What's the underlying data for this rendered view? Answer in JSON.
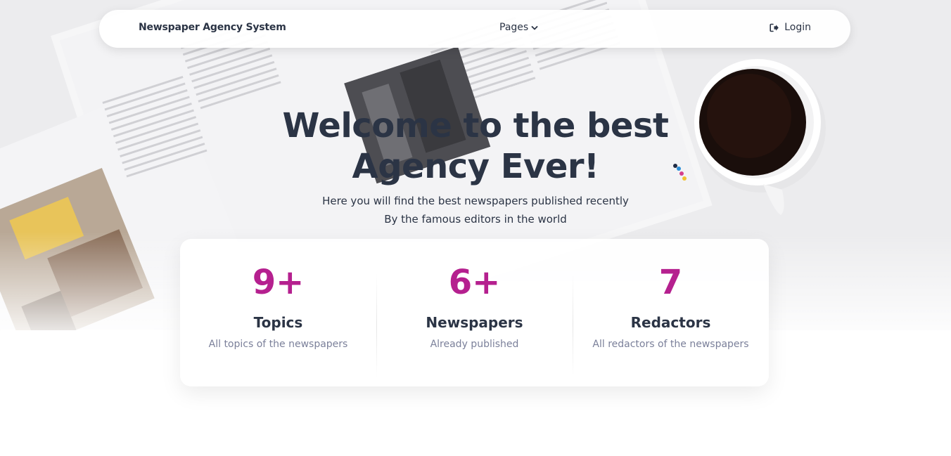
{
  "navbar": {
    "brand": "Newspaper Agency System",
    "pages_label": "Pages",
    "login_label": "Login"
  },
  "hero": {
    "title": "Welcome to the best Agency Ever!",
    "subtitle_line1": "Here you will find the best newspapers published recently",
    "subtitle_line2": "By the famous editors in the world"
  },
  "stats": [
    {
      "value": "9+",
      "title": "Topics",
      "description": "All topics of the newspapers"
    },
    {
      "value": "6+",
      "title": "Newspapers",
      "description": "Already published"
    },
    {
      "value": "7",
      "title": "Redactors",
      "description": "All redactors of the newspapers"
    }
  ],
  "colors": {
    "accent": "#b5208f",
    "text": "#2b3445",
    "muted": "#7b809a"
  },
  "icons": {
    "pages_dropdown": "chevron-down-icon",
    "login": "sign-in-icon"
  }
}
